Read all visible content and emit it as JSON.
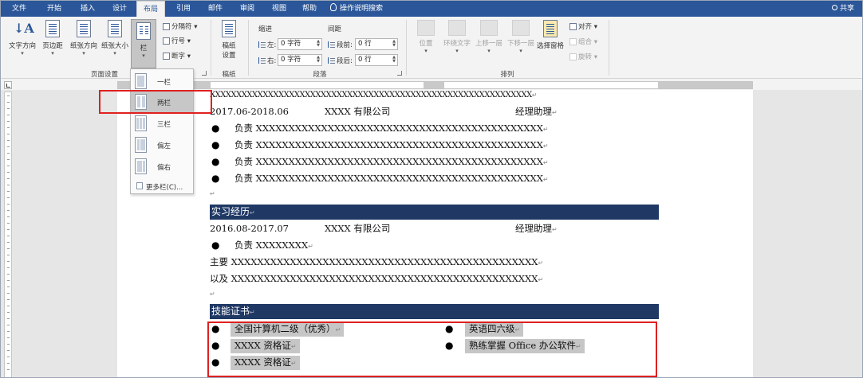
{
  "tabs": [
    {
      "label": "文件"
    },
    {
      "label": "开始"
    },
    {
      "label": "插入"
    },
    {
      "label": "设计"
    },
    {
      "label": "布局",
      "active": true
    },
    {
      "label": "引用"
    },
    {
      "label": "邮件"
    },
    {
      "label": "审阅"
    },
    {
      "label": "视图"
    },
    {
      "label": "帮助"
    }
  ],
  "tellme": "操作说明搜索",
  "share": "共享",
  "ribbon": {
    "page_setup": {
      "text_direction": "文字方向",
      "margins": "页边距",
      "orientation": "纸张方向",
      "size": "纸张大小",
      "columns": "栏",
      "breaks": "分隔符",
      "line_numbers": "行号",
      "hyphenation": "断字",
      "label": "页面设置"
    },
    "draft": {
      "button": "稿纸\n设置",
      "button_line1": "稿纸",
      "button_line2": "设置",
      "label": "稿纸"
    },
    "paragraph": {
      "indent_title": "缩进",
      "spacing_title": "间距",
      "left_label": "左:",
      "left_value": "0 字符",
      "right_label": "右:",
      "right_value": "0 字符",
      "before_label": "段前:",
      "before_value": "0 行",
      "after_label": "段后:",
      "after_value": "0 行",
      "label": "段落"
    },
    "arrange": {
      "position": "位置",
      "wrap": "环绕文字",
      "forward": "上移一层",
      "backward": "下移一层",
      "pane": "选择窗格",
      "align": "对齐",
      "group": "组合",
      "rotate": "旋转",
      "label": "排列"
    }
  },
  "columns_menu": {
    "items": [
      {
        "label": "一栏"
      },
      {
        "label": "两栏"
      },
      {
        "label": "三栏"
      },
      {
        "label": "偏左"
      },
      {
        "label": "偏右"
      }
    ],
    "more": "更多栏(C)..."
  },
  "document": {
    "top_line": "XXXXXXXXXXXXXXXXXXXXXXXXXXXXXXXXXXXXXXXXXXXXXXXXXXXXXXXXXXXXX",
    "job1": {
      "date": "2017.06-2018.06",
      "company": "XXXX 有限公司",
      "title": "经理助理"
    },
    "job1_bullets": [
      "负责 XXXXXXXXXXXXXXXXXXXXXXXXXXXXXXXXXXXXXXXXXXXX",
      "负责 XXXXXXXXXXXXXXXXXXXXXXXXXXXXXXXXXXXXXXXXXXXX",
      "负责 XXXXXXXXXXXXXXXXXXXXXXXXXXXXXXXXXXXXXXXXXXXX",
      "负责 XXXXXXXXXXXXXXXXXXXXXXXXXXXXXXXXXXXXXXXXXXXX"
    ],
    "section_intern": "实习经历",
    "job2": {
      "date": "2016.08-2017.07",
      "company": "XXXX 有限公司",
      "title": "经理助理"
    },
    "job2_bullet": "负责 XXXXXXXX",
    "job2_line1": "主要 XXXXXXXXXXXXXXXXXXXXXXXXXXXXXXXXXXXXXXXXXXXXXXX",
    "job2_line2": "以及 XXXXXXXXXXXXXXXXXXXXXXXXXXXXXXXXXXXXXXXXXXXXXXX",
    "section_skills": "技能证书",
    "skills_left": [
      "全国计算机二级（优秀）",
      "XXXX 资格证",
      "XXXX 资格证"
    ],
    "skills_right": [
      "英语四六级",
      "熟练掌握 Office 办公软件"
    ]
  },
  "colors": {
    "tab_bar": "#2b579a",
    "heading_bar": "#1f3864",
    "highlight_box": "#e02020",
    "selection": "#c6c6c6"
  }
}
